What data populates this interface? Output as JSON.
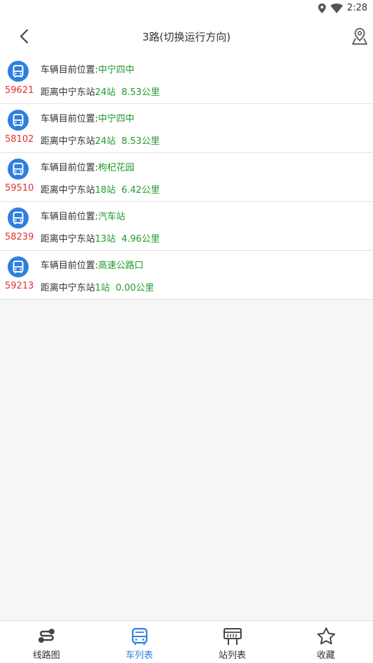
{
  "status_bar": {
    "time": "2:28"
  },
  "header": {
    "title": "3路(切换运行方向)"
  },
  "colors": {
    "accent": "#2f7fe0",
    "bus_number": "#e03030",
    "highlight": "#1f9a2a"
  },
  "vehicles": [
    {
      "bus_no": "59621",
      "position_label": "车辆目前位置:",
      "position": "中宁四中",
      "distance_prefix": "距离中宁东站",
      "stops": "24站",
      "distance": "8.53公里"
    },
    {
      "bus_no": "58102",
      "position_label": "车辆目前位置:",
      "position": "中宁四中",
      "distance_prefix": "距离中宁东站",
      "stops": "24站",
      "distance": "8.53公里"
    },
    {
      "bus_no": "59510",
      "position_label": "车辆目前位置:",
      "position": "枸杞花园",
      "distance_prefix": "距离中宁东站",
      "stops": "18站",
      "distance": "6.42公里"
    },
    {
      "bus_no": "58239",
      "position_label": "车辆目前位置:",
      "position": "汽车站",
      "distance_prefix": "距离中宁东站",
      "stops": "13站",
      "distance": "4.96公里"
    },
    {
      "bus_no": "59213",
      "position_label": "车辆目前位置:",
      "position": "高速公路口",
      "distance_prefix": "距离中宁东站",
      "stops": "1站",
      "distance": "0.00公里"
    }
  ],
  "bottom_nav": [
    {
      "label": "线路图",
      "icon": "route-icon",
      "active": false
    },
    {
      "label": "车列表",
      "icon": "bus-icon",
      "active": true
    },
    {
      "label": "站列表",
      "icon": "station-board-icon",
      "active": false
    },
    {
      "label": "收藏",
      "icon": "star-icon",
      "active": false
    }
  ]
}
